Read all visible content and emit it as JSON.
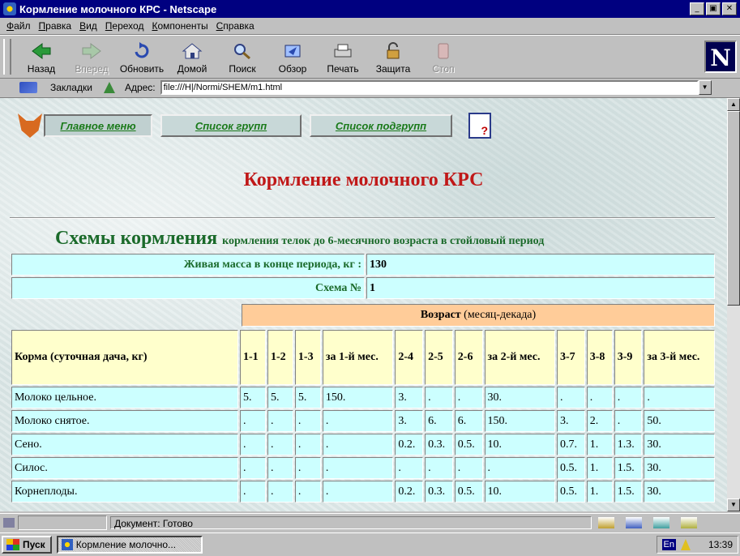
{
  "window": {
    "title": "Кормление молочного КРС - Netscape",
    "buttons": [
      "_",
      "▣",
      "✕"
    ]
  },
  "menu": [
    "Файл",
    "Правка",
    "Вид",
    "Переход",
    "Компоненты",
    "Справка"
  ],
  "toolbar": [
    {
      "label": "Назад",
      "icon": "back-arrow-icon",
      "enabled": true
    },
    {
      "label": "Вперед",
      "icon": "forward-arrow-icon",
      "enabled": false
    },
    {
      "label": "Обновить",
      "icon": "reload-icon",
      "enabled": true
    },
    {
      "label": "Домой",
      "icon": "home-icon",
      "enabled": true
    },
    {
      "label": "Поиск",
      "icon": "search-icon",
      "enabled": true
    },
    {
      "label": "Обзор",
      "icon": "guide-icon",
      "enabled": true
    },
    {
      "label": "Печать",
      "icon": "print-icon",
      "enabled": true
    },
    {
      "label": "Защита",
      "icon": "security-lock-icon",
      "enabled": true
    },
    {
      "label": "Стоп",
      "icon": "stop-icon",
      "enabled": false
    }
  ],
  "location": {
    "bookmarks_label": "Закладки",
    "address_label": "Адрес:",
    "url": "file:///H|/Normi/SHEM/m1.html"
  },
  "nav": {
    "main_menu": "Главное меню",
    "group_list": "Список групп",
    "subgroup_list": "Список подгрупп"
  },
  "page": {
    "title": "Кормление молочного КРС",
    "schemes_big": "Схемы кормления",
    "schemes_small": "кормления телок до 6-месячного возраста в стойловый период",
    "mass_label": "Живая масса в конце периода, кг :",
    "mass_value": "130",
    "scheme_label": "Схема №",
    "scheme_value": "1",
    "age_header": "Возраст",
    "age_header_note": "(месяц-декада)"
  },
  "table": {
    "feed_header": "Корма (суточная дача, кг)",
    "columns": [
      "1-1",
      "1-2",
      "1-3",
      "за 1-й мес.",
      "2-4",
      "2-5",
      "2-6",
      "за 2-й мес.",
      "3-7",
      "3-8",
      "3-9",
      "за 3-й мес."
    ],
    "rows": [
      {
        "name": "Молоко цельное.",
        "values": [
          "5.",
          "5.",
          "5.",
          "150.",
          "3.",
          ".",
          ".",
          "30.",
          ".",
          ".",
          ".",
          "."
        ]
      },
      {
        "name": "Молоко снятое.",
        "values": [
          ".",
          ".",
          ".",
          ".",
          "3.",
          "6.",
          "6.",
          "150.",
          "3.",
          "2.",
          ".",
          "50."
        ]
      },
      {
        "name": "Сено.",
        "values": [
          ".",
          ".",
          ".",
          ".",
          "0.2.",
          "0.3.",
          "0.5.",
          "10.",
          "0.7.",
          "1.",
          "1.3.",
          "30."
        ]
      },
      {
        "name": "Силос.",
        "values": [
          ".",
          ".",
          ".",
          ".",
          ".",
          ".",
          ".",
          ".",
          "0.5.",
          "1.",
          "1.5.",
          "30."
        ]
      },
      {
        "name": "Корнеплоды.",
        "values": [
          ".",
          ".",
          ".",
          ".",
          "0.2.",
          "0.3.",
          "0.5.",
          "10.",
          "0.5.",
          "1.",
          "1.5.",
          "30."
        ]
      }
    ]
  },
  "status": {
    "text": "Документ: Готово"
  },
  "taskbar": {
    "start": "Пуск",
    "task": "Кормление молочно...",
    "lang": "En",
    "time": "13:39"
  }
}
